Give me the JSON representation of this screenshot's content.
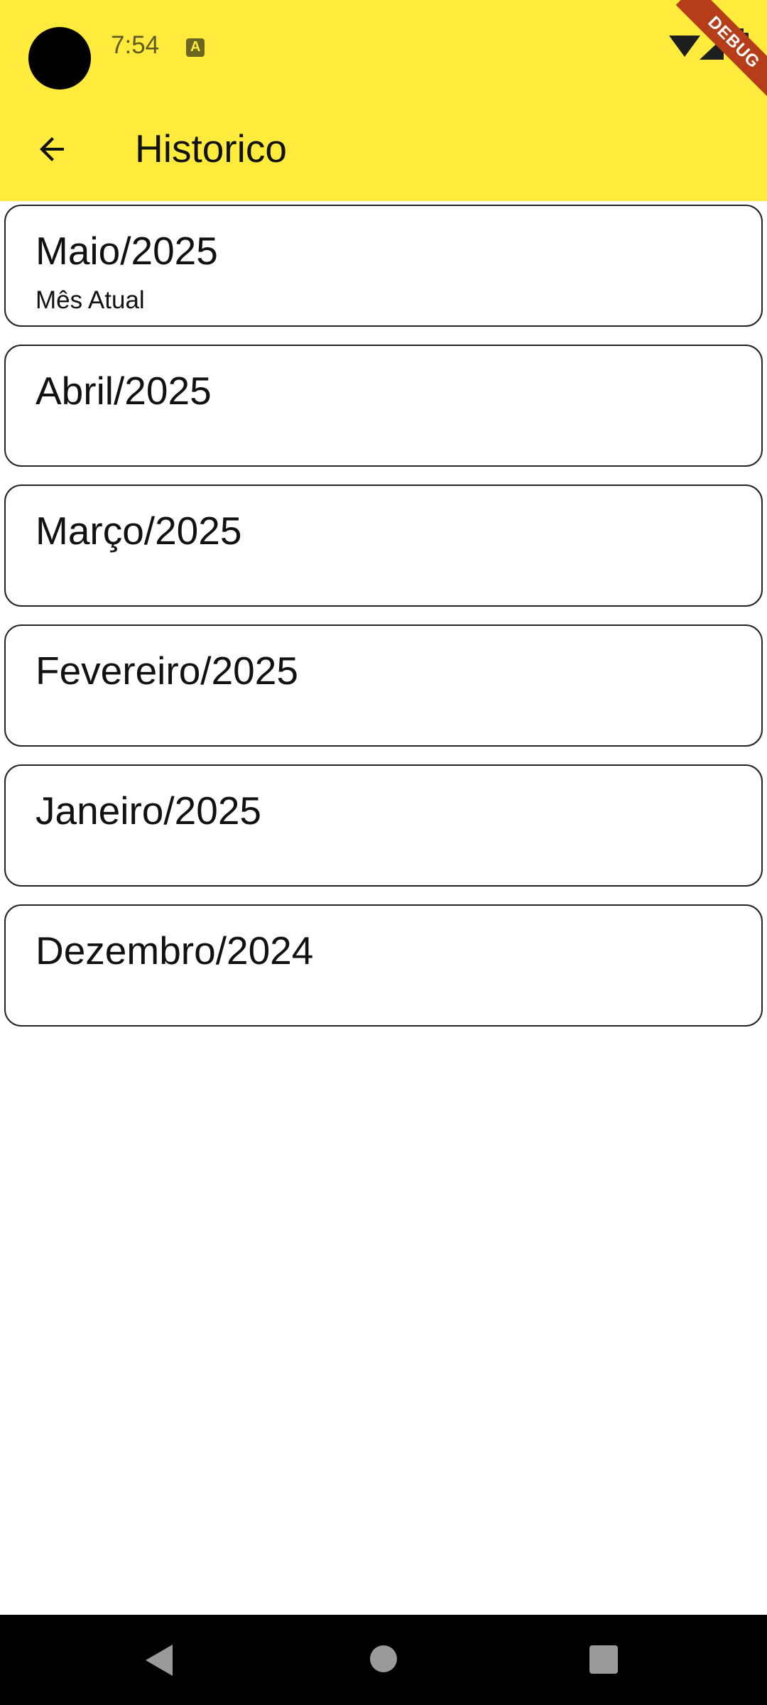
{
  "status_bar": {
    "time": "7:54"
  },
  "debug_banner": "DEBUG",
  "app_bar": {
    "title": "Historico",
    "back_icon": "arrow-back-icon"
  },
  "months": [
    {
      "title": "Maio/2025",
      "subtitle": "Mês Atual"
    },
    {
      "title": "Abril/2025",
      "subtitle": ""
    },
    {
      "title": "Março/2025",
      "subtitle": ""
    },
    {
      "title": "Fevereiro/2025",
      "subtitle": ""
    },
    {
      "title": "Janeiro/2025",
      "subtitle": ""
    },
    {
      "title": "Dezembro/2024",
      "subtitle": ""
    }
  ],
  "colors": {
    "app_bar": "#ffeb3b",
    "card_border": "#222222",
    "debug_ribbon": "#b53d1a"
  }
}
